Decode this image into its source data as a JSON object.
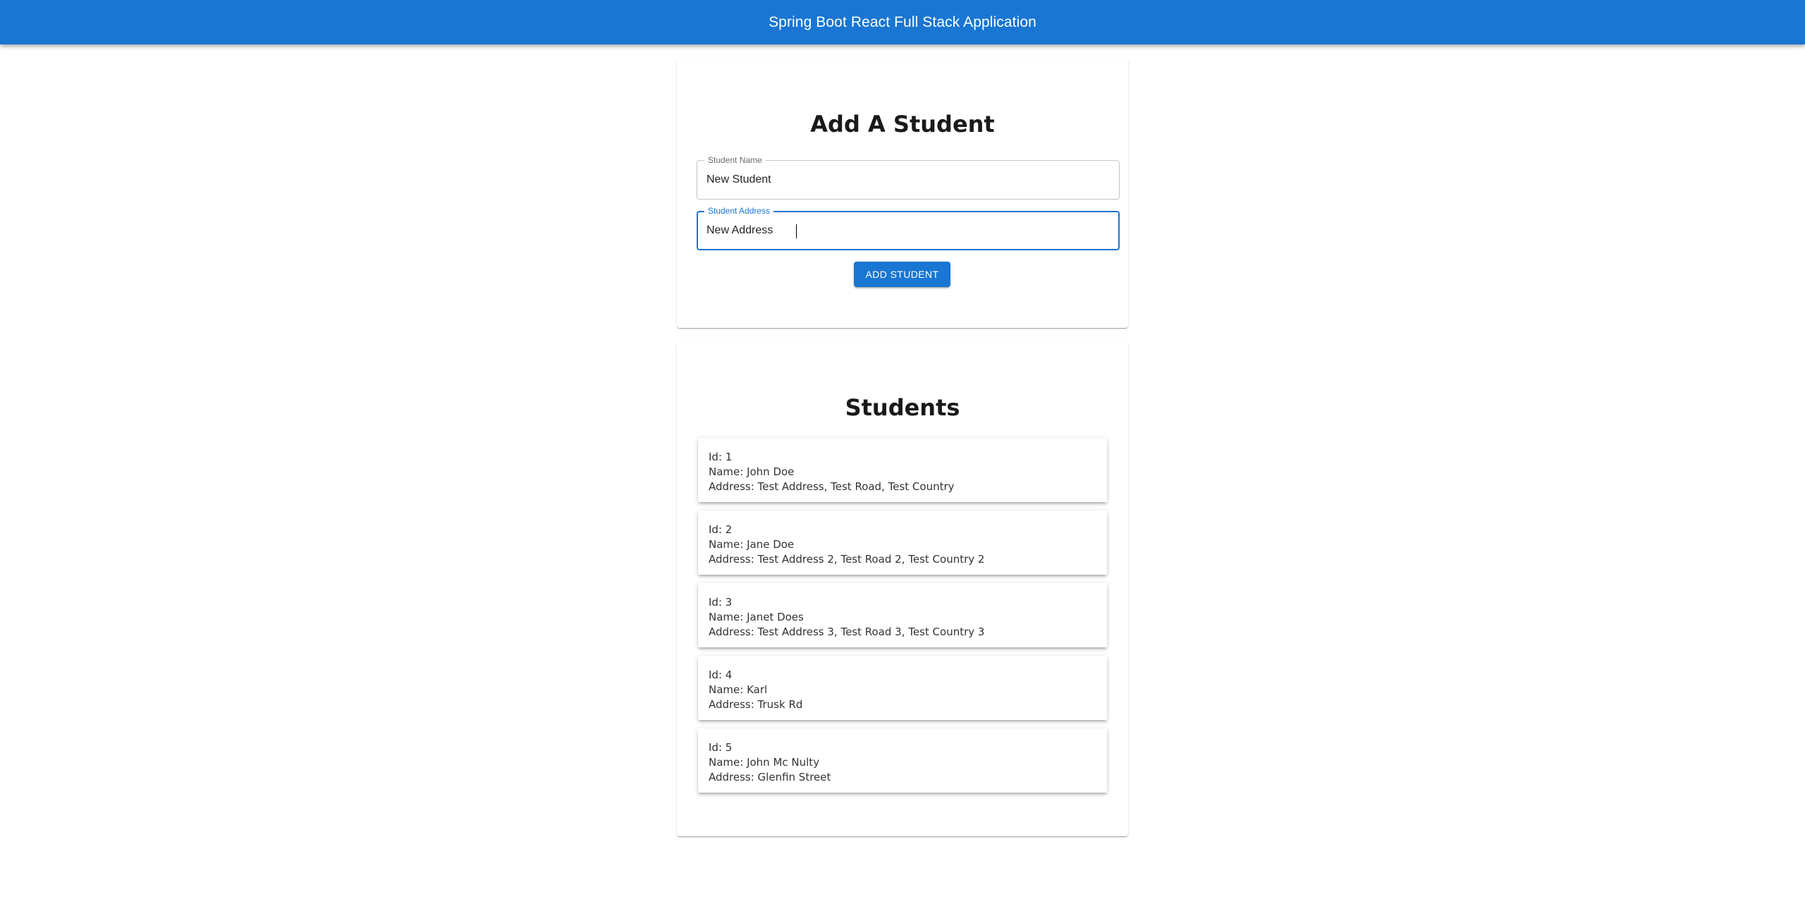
{
  "appbar": {
    "title": "Spring Boot React Full Stack Application"
  },
  "form": {
    "title": "Add A Student",
    "name_label": "Student Name",
    "name_value": "New Student",
    "address_label": "Student Address",
    "address_value": "New Address",
    "submit_label": "ADD STUDENT"
  },
  "students": {
    "title": "Students",
    "items": [
      {
        "id": "Id: 1",
        "name": "Name: John Doe",
        "address": "Address: Test Address, Test Road, Test Country"
      },
      {
        "id": "Id: 2",
        "name": "Name: Jane Doe",
        "address": "Address: Test Address 2, Test Road 2, Test Country 2"
      },
      {
        "id": "Id: 3",
        "name": "Name: Janet Does",
        "address": "Address: Test Address 3, Test Road 3, Test Country 3"
      },
      {
        "id": "Id: 4",
        "name": "Name: Karl",
        "address": "Address: Trusk Rd"
      },
      {
        "id": "Id: 5",
        "name": "Name: John Mc Nulty",
        "address": "Address: Glenfin Street"
      }
    ]
  },
  "colors": {
    "primary": "#1976d2",
    "background": "#ffffff"
  }
}
